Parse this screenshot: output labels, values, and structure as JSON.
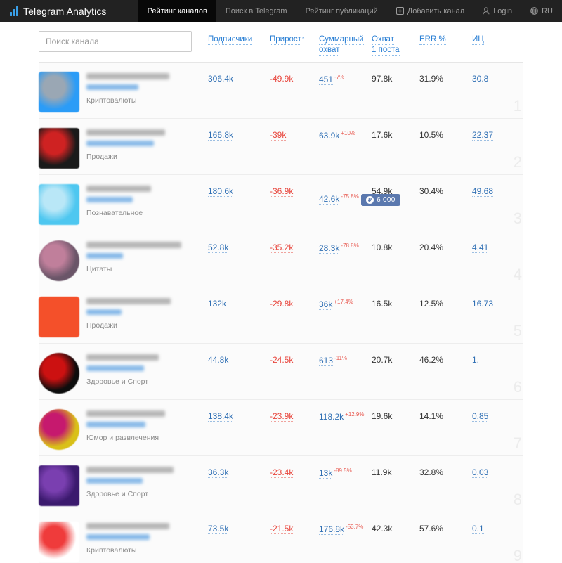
{
  "navbar": {
    "brand": "Telegram Analytics",
    "brand_logo_icon": "bar-chart-icon",
    "items": [
      {
        "label": "Рейтинг каналов",
        "active": true,
        "icon": null
      },
      {
        "label": "Поиск в Telegram",
        "active": false,
        "icon": null
      },
      {
        "label": "Рейтинг публикаций",
        "active": false,
        "icon": null
      },
      {
        "label": "Добавить канал",
        "active": false,
        "icon": "plus-square-icon"
      },
      {
        "label": "Login",
        "active": false,
        "icon": "user-icon"
      },
      {
        "label": "RU",
        "active": false,
        "icon": "globe-icon"
      }
    ]
  },
  "search": {
    "placeholder": "Поиск канала",
    "value": ""
  },
  "table": {
    "columns": [
      {
        "key": "subscribers",
        "label": "Подписчики",
        "sorted": false
      },
      {
        "key": "growth",
        "label": "Прирост",
        "sorted": true,
        "sort_arrow": "↑"
      },
      {
        "key": "total_reach",
        "label": "Суммарный",
        "label2": "охват",
        "sorted": false
      },
      {
        "key": "post_reach",
        "label": "Охват",
        "label2": "1 поста",
        "sorted": false
      },
      {
        "key": "err",
        "label": "ERR %",
        "sorted": false
      },
      {
        "key": "ii",
        "label": "ИЦ",
        "sorted": false
      }
    ],
    "rows": [
      {
        "rank": "1",
        "category": "Криптовалюты",
        "avatar_shape": "square",
        "avatar_colors": [
          "#2b9cf7",
          "#9aa7b4"
        ],
        "subscribers": "306.4k",
        "growth": "-49.9k",
        "total_reach": "451",
        "total_reach_delta": "-7%",
        "post_reach": "97.8k",
        "err": "31.9%",
        "ii": "30.8",
        "badge": null
      },
      {
        "rank": "2",
        "category": "Продажи",
        "avatar_shape": "square",
        "avatar_colors": [
          "#1a1a1a",
          "#cf2222"
        ],
        "subscribers": "166.8k",
        "growth": "-39k",
        "total_reach": "63.9k",
        "total_reach_delta": "+10%",
        "post_reach": "17.6k",
        "err": "10.5%",
        "ii": "22.37",
        "badge": null
      },
      {
        "rank": "3",
        "category": "Познавательное",
        "avatar_shape": "square",
        "avatar_colors": [
          "#4ec7f0",
          "#b9e7f7"
        ],
        "subscribers": "180.6k",
        "growth": "-36.9k",
        "total_reach": "42.6k",
        "total_reach_delta": "-75.8%",
        "post_reach": "54.9k",
        "err": "30.4%",
        "ii": "49.68",
        "badge": {
          "icon": "ruble-icon",
          "symbol": "₽",
          "amount": "6 000"
        }
      },
      {
        "rank": "4",
        "category": "Цитаты",
        "avatar_shape": "round",
        "avatar_colors": [
          "#6a5568",
          "#c07f9b"
        ],
        "subscribers": "52.8k",
        "growth": "-35.2k",
        "total_reach": "28.3k",
        "total_reach_delta": "-78.8%",
        "post_reach": "10.8k",
        "err": "20.4%",
        "ii": "4.41",
        "badge": null
      },
      {
        "rank": "5",
        "category": "Продажи",
        "avatar_shape": "square",
        "avatar_colors": [
          "#f4502a",
          "#f4502a"
        ],
        "subscribers": "132k",
        "growth": "-29.8k",
        "total_reach": "36k",
        "total_reach_delta": "+17.4%",
        "post_reach": "16.5k",
        "err": "12.5%",
        "ii": "16.73",
        "badge": null
      },
      {
        "rank": "6",
        "category": "Здоровье и Спорт",
        "avatar_shape": "round",
        "avatar_colors": [
          "#0d0d0d",
          "#cc1111"
        ],
        "subscribers": "44.8k",
        "growth": "-24.5k",
        "total_reach": "613",
        "total_reach_delta": "-11%",
        "post_reach": "20.7k",
        "err": "46.2%",
        "ii": "1.",
        "badge": null
      },
      {
        "rank": "7",
        "category": "Юмор и развлечения",
        "avatar_shape": "round",
        "avatar_colors": [
          "#d9c018",
          "#c6196e"
        ],
        "subscribers": "138.4k",
        "growth": "-23.9k",
        "total_reach": "118.2k",
        "total_reach_delta": "+12.9%",
        "post_reach": "19.6k",
        "err": "14.1%",
        "ii": "0.85",
        "badge": null
      },
      {
        "rank": "8",
        "category": "Здоровье и Спорт",
        "avatar_shape": "square",
        "avatar_colors": [
          "#3b1a6e",
          "#7a3fb0"
        ],
        "subscribers": "36.3k",
        "growth": "-23.4k",
        "total_reach": "13k",
        "total_reach_delta": "-89.5%",
        "post_reach": "11.9k",
        "err": "32.8%",
        "ii": "0.03",
        "badge": null
      },
      {
        "rank": "9",
        "category": "Криптовалюты",
        "avatar_shape": "square",
        "avatar_colors": [
          "#ffffff",
          "#ef3b3b"
        ],
        "subscribers": "73.5k",
        "growth": "-21.5k",
        "total_reach": "176.8k",
        "total_reach_delta": "-53.7%",
        "post_reach": "42.3k",
        "err": "57.6%",
        "ii": "0.1",
        "badge": null
      }
    ]
  },
  "colors": {
    "navbar_bg": "#222222",
    "accent_blue": "#2a7fd4",
    "negative_red": "#e8453c",
    "brand_logo": "#3aa0e8",
    "row_bg": "#fbfbfb",
    "badge_bg": "#5a78ae"
  }
}
